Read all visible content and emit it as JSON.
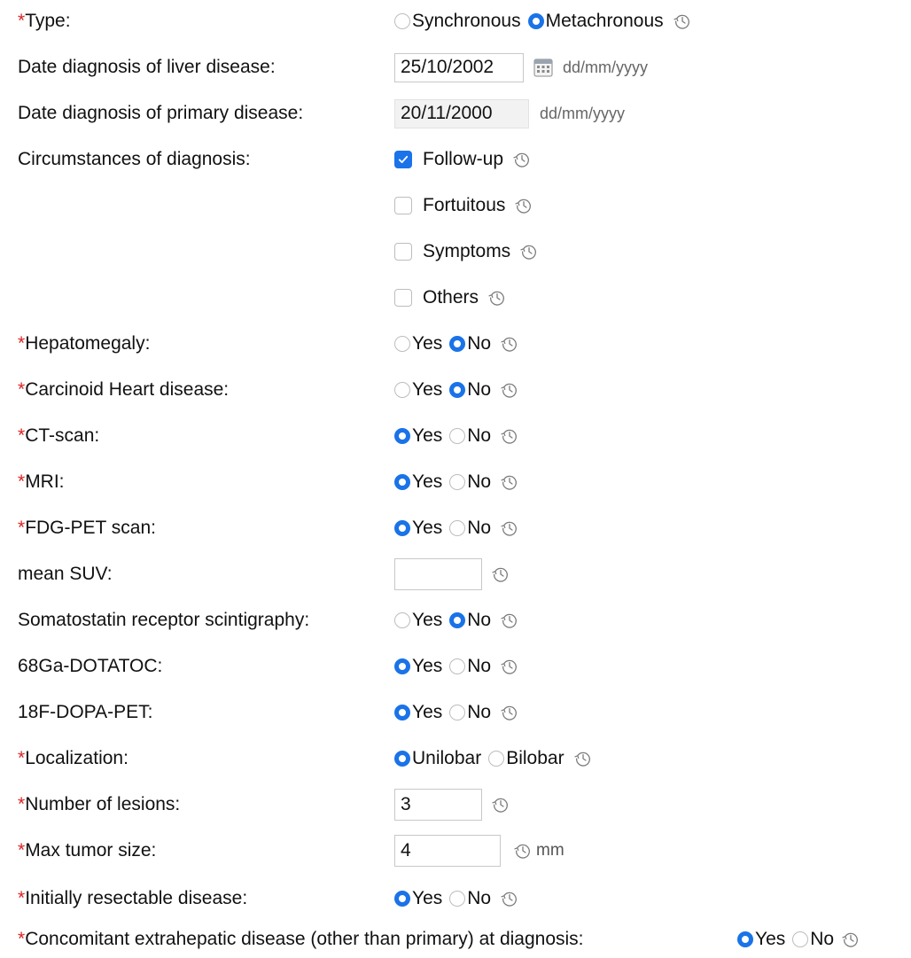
{
  "form": {
    "type": {
      "label": "Type:",
      "required": true,
      "options": [
        "Synchronous",
        "Metachronous"
      ],
      "selected": "Metachronous"
    },
    "date_liver": {
      "label": "Date diagnosis of liver disease:",
      "value": "25/10/2002",
      "hint": "dd/mm/yyyy"
    },
    "date_primary": {
      "label": "Date diagnosis of primary disease:",
      "value": "20/11/2000",
      "hint": "dd/mm/yyyy"
    },
    "circumstances": {
      "label": "Circumstances of diagnosis:",
      "options": [
        {
          "label": "Follow-up",
          "checked": true
        },
        {
          "label": "Fortuitous",
          "checked": false
        },
        {
          "label": "Symptoms",
          "checked": false
        },
        {
          "label": "Others",
          "checked": false
        }
      ]
    },
    "hepatomegaly": {
      "label": "Hepatomegaly:",
      "required": true,
      "yes": "Yes",
      "no": "No",
      "selected": "No"
    },
    "carcinoid": {
      "label": "Carcinoid Heart disease:",
      "required": true,
      "yes": "Yes",
      "no": "No",
      "selected": "No"
    },
    "ct_scan": {
      "label": "CT-scan:",
      "required": true,
      "yes": "Yes",
      "no": "No",
      "selected": "Yes"
    },
    "mri": {
      "label": "MRI:",
      "required": true,
      "yes": "Yes",
      "no": "No",
      "selected": "Yes"
    },
    "fdg_pet": {
      "label": "FDG-PET scan:",
      "required": true,
      "yes": "Yes",
      "no": "No",
      "selected": "Yes"
    },
    "mean_suv": {
      "label": "mean SUV:",
      "value": ""
    },
    "somatostatin": {
      "label": "Somatostatin receptor scintigraphy:",
      "yes": "Yes",
      "no": "No",
      "selected": "No"
    },
    "ga_dotatoc": {
      "label": "68Ga-DOTATOC:",
      "yes": "Yes",
      "no": "No",
      "selected": "Yes"
    },
    "f_dopa": {
      "label": "18F-DOPA-PET:",
      "yes": "Yes",
      "no": "No",
      "selected": "Yes"
    },
    "localization": {
      "label": "Localization:",
      "required": true,
      "options": [
        "Unilobar",
        "Bilobar"
      ],
      "selected": "Unilobar"
    },
    "num_lesions": {
      "label": "Number of lesions:",
      "required": true,
      "value": "3"
    },
    "max_tumor": {
      "label": "Max tumor size:",
      "required": true,
      "value": "4",
      "unit": "mm"
    },
    "resectable": {
      "label": "Initially resectable disease:",
      "required": true,
      "yes": "Yes",
      "no": "No",
      "selected": "Yes"
    },
    "extrahepatic": {
      "label": "Concomitant extrahepatic disease (other than primary) at diagnosis:",
      "required": true,
      "yes": "Yes",
      "no": "No",
      "selected": "Yes"
    }
  },
  "required_marker": "*",
  "icons": {
    "history": "history-icon",
    "calendar": "calendar-icon",
    "checkmark": "checkmark-icon"
  },
  "colors": {
    "accent": "#1a73e8",
    "required": "#dd2222"
  }
}
